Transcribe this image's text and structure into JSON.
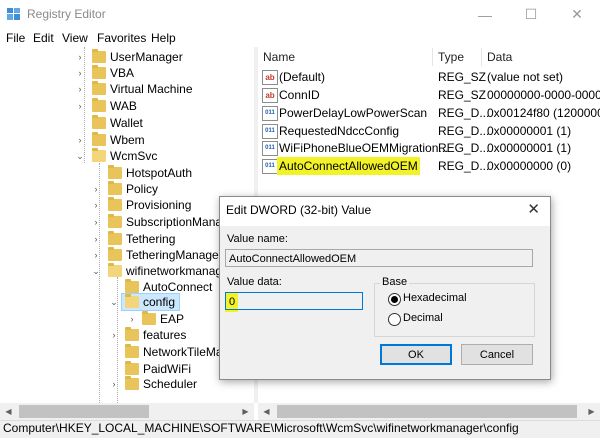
{
  "window": {
    "title": "Registry Editor",
    "minimize_glyph": "—",
    "maximize_glyph": "☐",
    "close_glyph": "✕"
  },
  "menu": [
    "File",
    "Edit",
    "View",
    "Favorites",
    "Help"
  ],
  "tree": {
    "items": [
      {
        "label": "UserManager"
      },
      {
        "label": "VBA"
      },
      {
        "label": "Virtual Machine"
      },
      {
        "label": "WAB"
      },
      {
        "label": "Wallet"
      },
      {
        "label": "Wbem"
      },
      {
        "label": "WcmSvc"
      },
      {
        "label": "HotspotAuth"
      },
      {
        "label": "Policy"
      },
      {
        "label": "Provisioning"
      },
      {
        "label": "SubscriptionManag"
      },
      {
        "label": "Tethering"
      },
      {
        "label": "TetheringManager"
      },
      {
        "label": "wifinetworkmanag"
      },
      {
        "label": "AutoConnect"
      },
      {
        "label": "config"
      },
      {
        "label": "EAP"
      },
      {
        "label": "features"
      },
      {
        "label": "NetworkTileMa"
      },
      {
        "label": "PaidWiFi"
      },
      {
        "label": "Scheduler"
      }
    ]
  },
  "list": {
    "headers": {
      "name": "Name",
      "type": "Type",
      "data": "Data"
    },
    "rows": [
      {
        "icon": "ab",
        "name": "(Default)",
        "type": "REG_SZ",
        "data": "(value not set)"
      },
      {
        "icon": "ab",
        "name": "ConnID",
        "type": "REG_SZ",
        "data": "00000000-0000-0000-"
      },
      {
        "icon": "011",
        "name": "PowerDelayLowPowerScan",
        "type": "REG_D...",
        "data": "0x00124f80 (1200000)"
      },
      {
        "icon": "011",
        "name": "RequestedNdccConfig",
        "type": "REG_D...",
        "data": "0x00000001 (1)"
      },
      {
        "icon": "011",
        "name": "WiFiPhoneBlueOEMMigration...",
        "type": "REG_D...",
        "data": "0x00000001 (1)"
      },
      {
        "icon": "011",
        "name": "AutoConnectAllowedOEM",
        "type": "REG_D...",
        "data": "0x00000000 (0)"
      }
    ]
  },
  "statusbar": {
    "path": "Computer\\HKEY_LOCAL_MACHINE\\SOFTWARE\\Microsoft\\WcmSvc\\wifinetworkmanager\\config"
  },
  "dialog": {
    "title": "Edit DWORD (32-bit) Value",
    "value_name_label": "Value name:",
    "value_name": "AutoConnectAllowedOEM",
    "value_data_label": "Value data:",
    "value_data": "0",
    "base_label": "Base",
    "base_options": [
      "Hexadecimal",
      "Decimal"
    ],
    "base_selected": "Hexadecimal",
    "ok_label": "OK",
    "cancel_label": "Cancel"
  },
  "colors": {
    "highlight": "#f2f229",
    "selection": "#cce8ff",
    "folder": "#e8c45a",
    "accent": "#0078d7"
  }
}
